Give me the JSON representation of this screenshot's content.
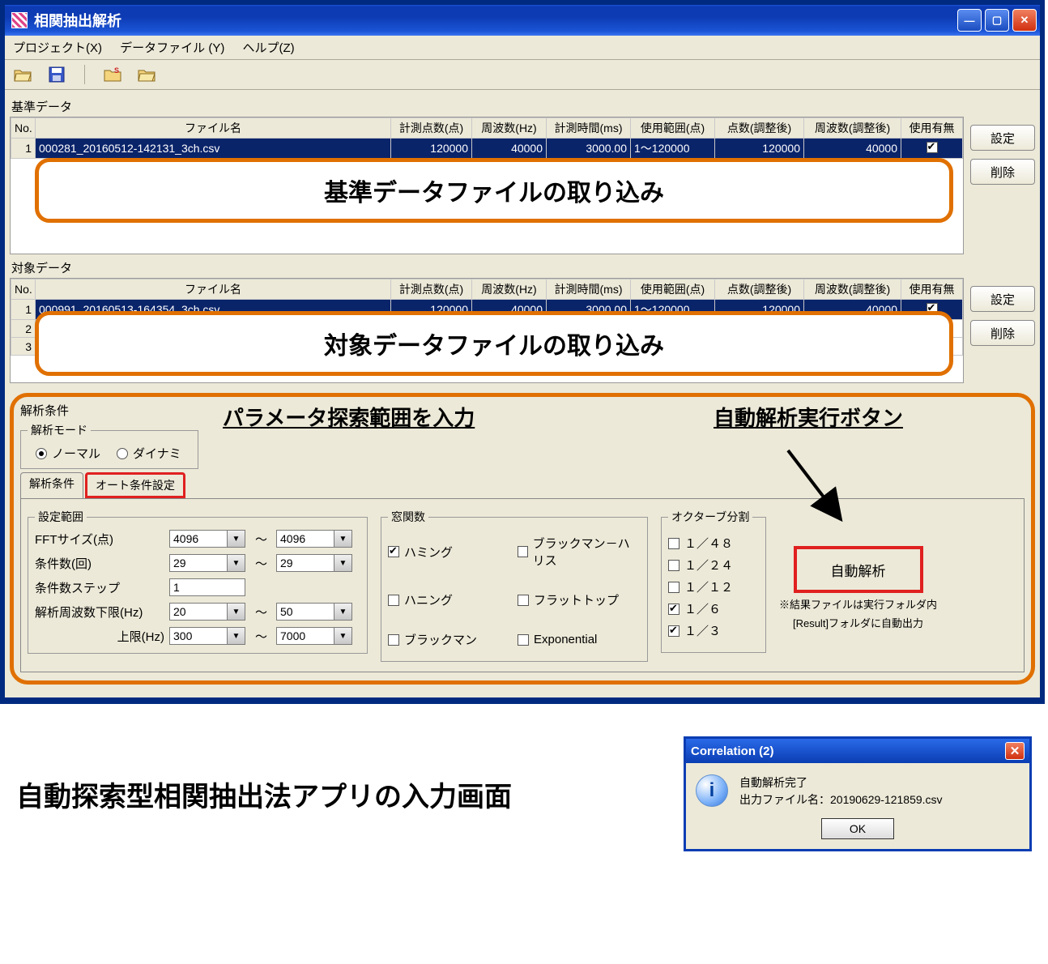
{
  "window": {
    "title": "相関抽出解析"
  },
  "menubar": {
    "project": "プロジェクト(X)",
    "datafile": "データファイル (Y)",
    "help": "ヘルプ(Z)"
  },
  "sections": {
    "ref_label": "基準データ",
    "tgt_label": "対象データ",
    "analysis_label": "解析条件"
  },
  "grid_headers": {
    "no": "No.",
    "filename": "ファイル名",
    "points": "計測点数(点)",
    "freq": "周波数(Hz)",
    "time_ms": "計測時間(ms)",
    "range": "使用範囲(点)",
    "points_adj": "点数(調整後)",
    "freq_adj": "周波数(調整後)",
    "use": "使用有無"
  },
  "ref_rows": [
    {
      "no": "1",
      "filename": "000281_20160512-142131_3ch.csv",
      "points": "120000",
      "freq": "40000",
      "time_ms": "3000.00",
      "range": "1～120000",
      "points_adj": "120000",
      "freq_adj": "40000",
      "use": true,
      "selected": true
    }
  ],
  "tgt_rows": [
    {
      "no": "1",
      "filename": "000991_20160513-164354_3ch.csv",
      "points": "120000",
      "freq": "40000",
      "time_ms": "3000.00",
      "range": "1～120000",
      "points_adj": "120000",
      "freq_adj": "40000",
      "use": true,
      "selected": true
    },
    {
      "no": "2",
      "filename": "",
      "points": "",
      "freq": "",
      "time_ms": "",
      "range": "",
      "points_adj": "",
      "freq_adj": "",
      "use": false,
      "selected": false
    },
    {
      "no": "3",
      "filename": "",
      "points": "",
      "freq": "",
      "time_ms": "",
      "range": "",
      "points_adj": "",
      "freq_adj": "",
      "use": false,
      "selected": false
    }
  ],
  "buttons": {
    "settei": "設定",
    "sakujo": "削除"
  },
  "overlays": {
    "ref_import": "基準データファイルの取り込み",
    "tgt_import": "対象データファイルの取り込み",
    "param_label": "パラメータ探索範囲を入力",
    "auto_label": "自動解析実行ボタン"
  },
  "mode": {
    "legend": "解析モード",
    "normal": "ノーマル",
    "dynamic": "ダイナミ"
  },
  "tabs": {
    "cond": "解析条件",
    "auto": "オート条件設定"
  },
  "setrange": {
    "legend": "設定範囲",
    "fft_label": "FFTサイズ(点)",
    "fft_from": "4096",
    "fft_to": "4096",
    "cond_label": "条件数(回)",
    "cond_from": "29",
    "cond_to": "29",
    "step_label": "条件数ステップ",
    "step_val": "1",
    "freq_lo_label": "解析周波数下限(Hz)",
    "freq_lo_from": "20",
    "freq_lo_to": "50",
    "freq_hi_label": "上限(Hz)",
    "freq_hi_from": "300",
    "freq_hi_to": "7000",
    "tilde": "～"
  },
  "winfn": {
    "legend": "窓関数",
    "hamming": "ハミング",
    "hanning": "ハニング",
    "blackman": "ブラックマン",
    "blackman_harris": "ブラックマン－ハリス",
    "flattop": "フラットトップ",
    "exponential": "Exponential"
  },
  "octave": {
    "legend": "オクターブ分割",
    "o48": "１／４８",
    "o24": "１／２４",
    "o12": "１／１２",
    "o6": "１／６",
    "o3": "１／３"
  },
  "autobtn": {
    "label": "自動解析",
    "note1": "※結果ファイルは実行フォルダ内",
    "note2": "[Result]フォルダに自動出力"
  },
  "bottom": {
    "title": "自動探索型相関抽出法アプリの入力画面"
  },
  "msgbox": {
    "title": "Correlation (2)",
    "line1": "自動解析完了",
    "line2": "出力ファイル名：20190629-121859.csv",
    "ok": "OK"
  }
}
